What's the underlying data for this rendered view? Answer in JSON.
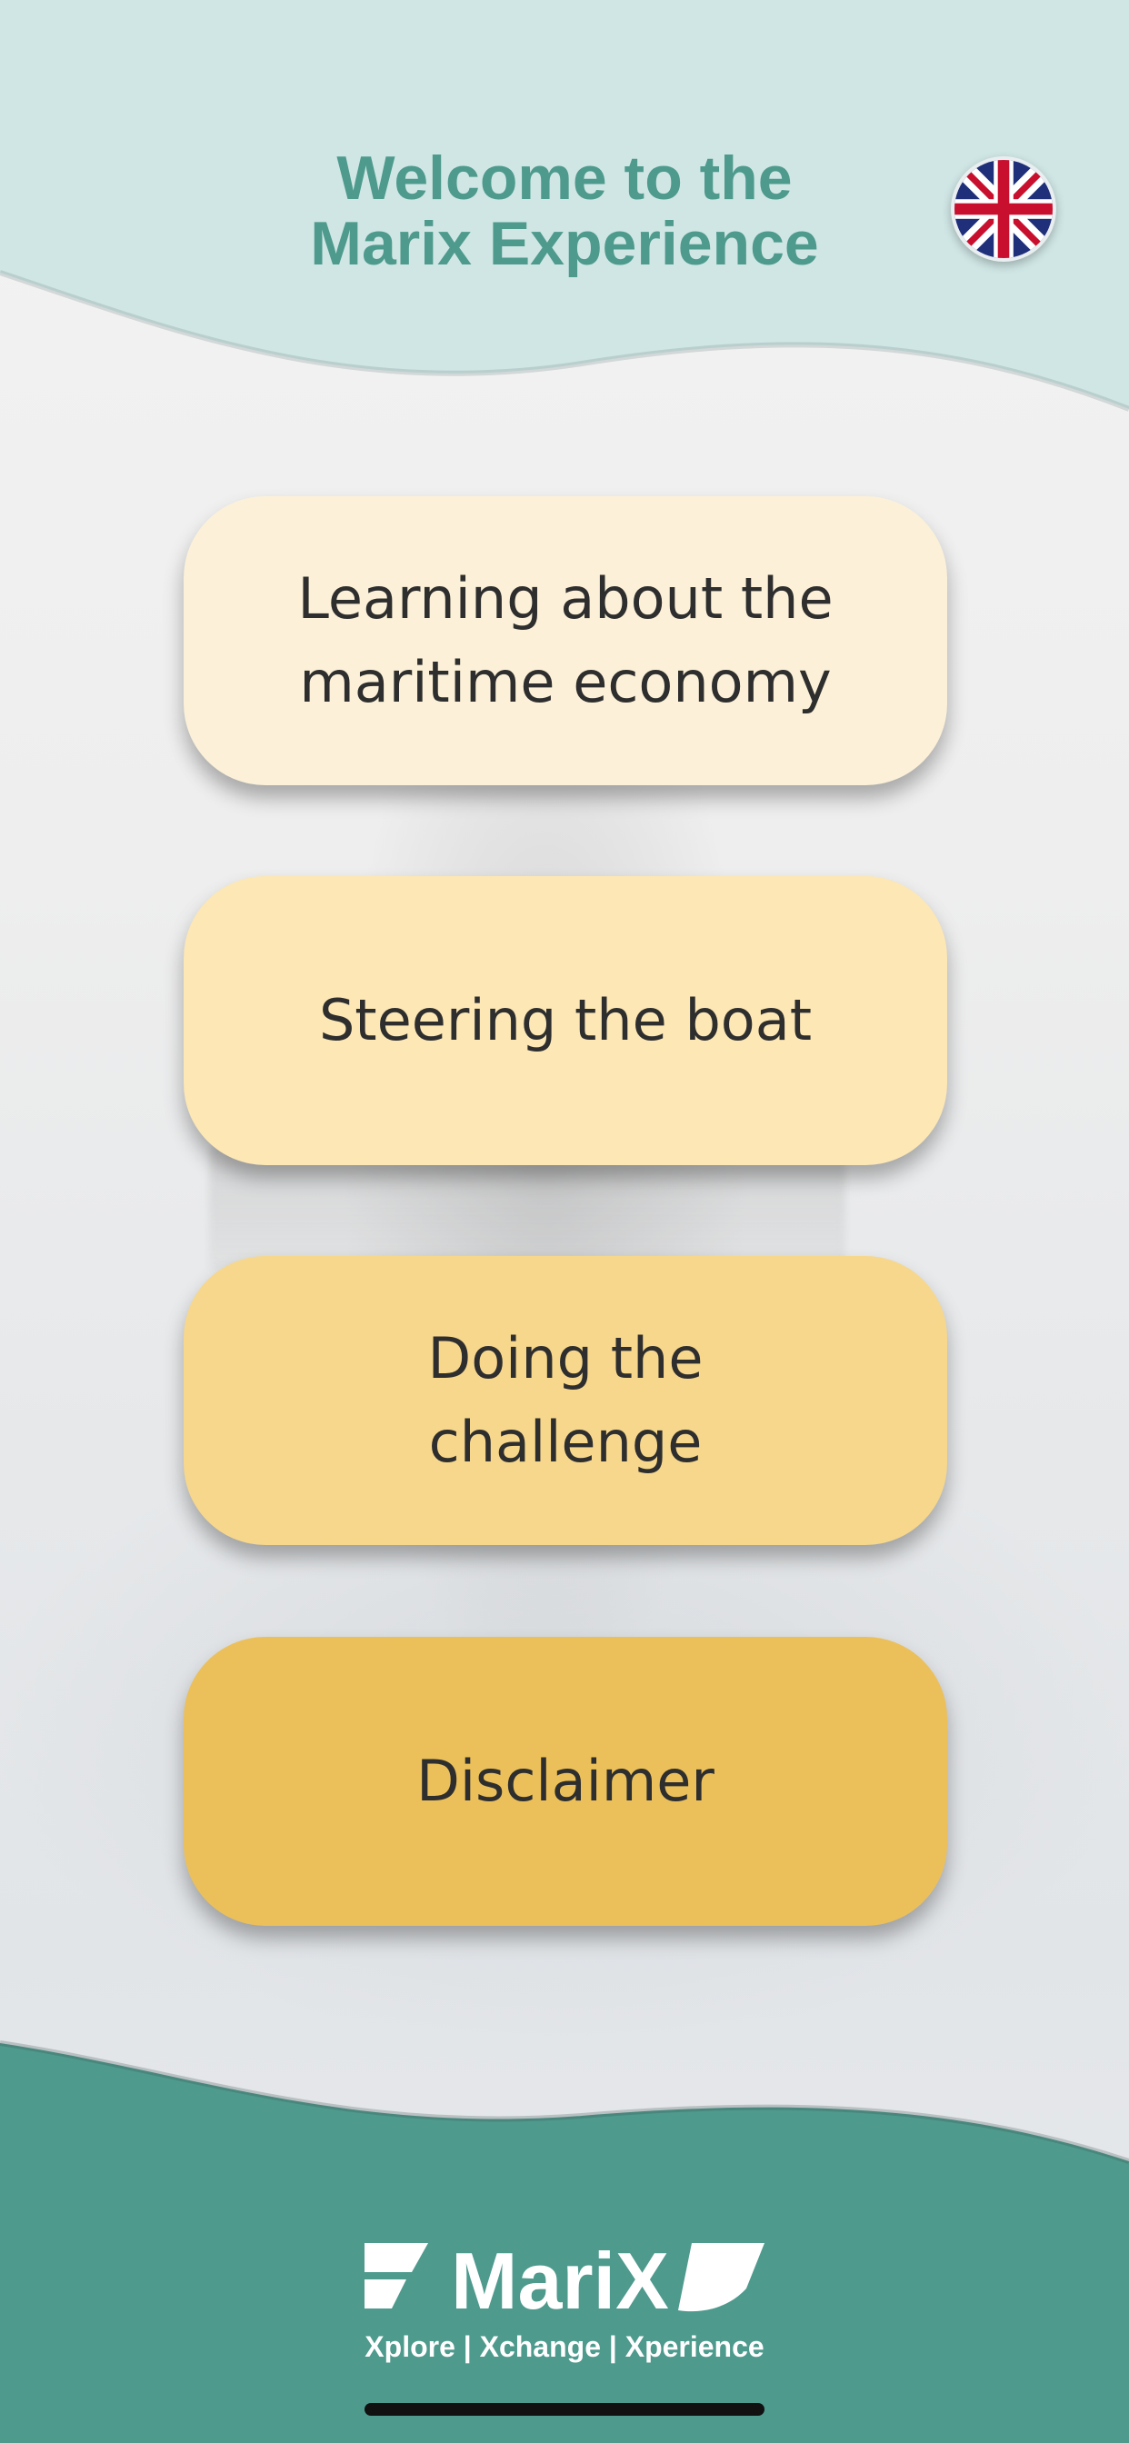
{
  "header": {
    "title_line1": "Welcome to the",
    "title_line2": "Marix Experience",
    "language_icon": "uk-flag-icon"
  },
  "menu": {
    "items": [
      {
        "label": "Learning about the maritime economy"
      },
      {
        "label": "Steering the boat"
      },
      {
        "label": "Doing the challenge"
      },
      {
        "label": "Disclaimer"
      }
    ]
  },
  "footer": {
    "logo_text": "MariX",
    "tagline": "Xplore | Xchange | Xperience"
  },
  "colors": {
    "brand_teal": "#4e9a8d",
    "header_bg": "#cfe6e4",
    "btn_1": "#fcf1d8",
    "btn_2": "#fce7b5",
    "btn_3": "#f6d78c",
    "btn_4": "#ebc05a"
  }
}
